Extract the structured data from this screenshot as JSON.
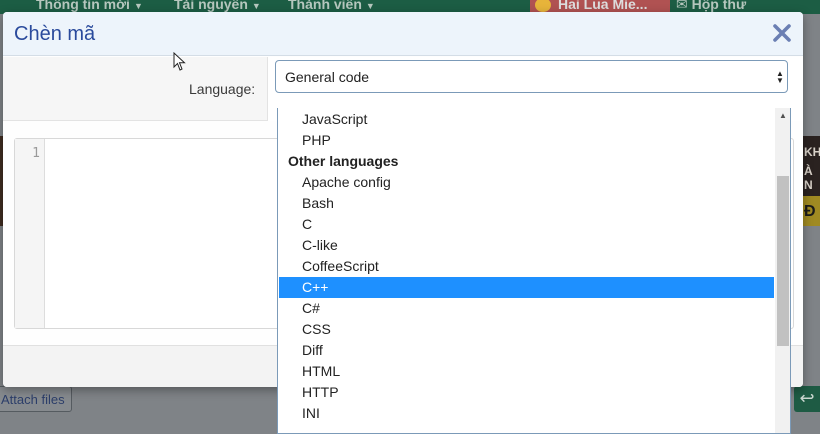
{
  "background": {
    "nav_items": [
      {
        "label": "Thông tin mới"
      },
      {
        "label": "Tài nguyên"
      },
      {
        "label": "Thành viên"
      }
    ],
    "user_name": "Hai Lua Mie...",
    "inbox_label": "Hộp thư",
    "banner_text_1": "KH",
    "banner_text_2": "À N",
    "banner_text_3": "Đ",
    "attach_label": "Attach files",
    "reply_icon": "reply-icon"
  },
  "modal": {
    "title": "Chèn mã",
    "close_icon": "close-icon",
    "language_label": "Language:",
    "language_selected": "General code",
    "line_number": "1"
  },
  "dropdown": {
    "options": [
      {
        "label": "JavaScript"
      },
      {
        "label": "PHP"
      },
      {
        "label": "Other languages"
      },
      {
        "label": "Apache config"
      },
      {
        "label": "Bash"
      },
      {
        "label": "C"
      },
      {
        "label": "C-like"
      },
      {
        "label": "CoffeeScript"
      },
      {
        "label": "C++"
      },
      {
        "label": "C#"
      },
      {
        "label": "CSS"
      },
      {
        "label": "Diff"
      },
      {
        "label": "HTML"
      },
      {
        "label": "HTTP"
      },
      {
        "label": "INI"
      }
    ],
    "highlighted_option": "C++",
    "group_header": "Other languages"
  },
  "colors": {
    "accent": "#1e90ff",
    "title": "#2a4a9c",
    "nav_bg": "#1c5d44"
  }
}
